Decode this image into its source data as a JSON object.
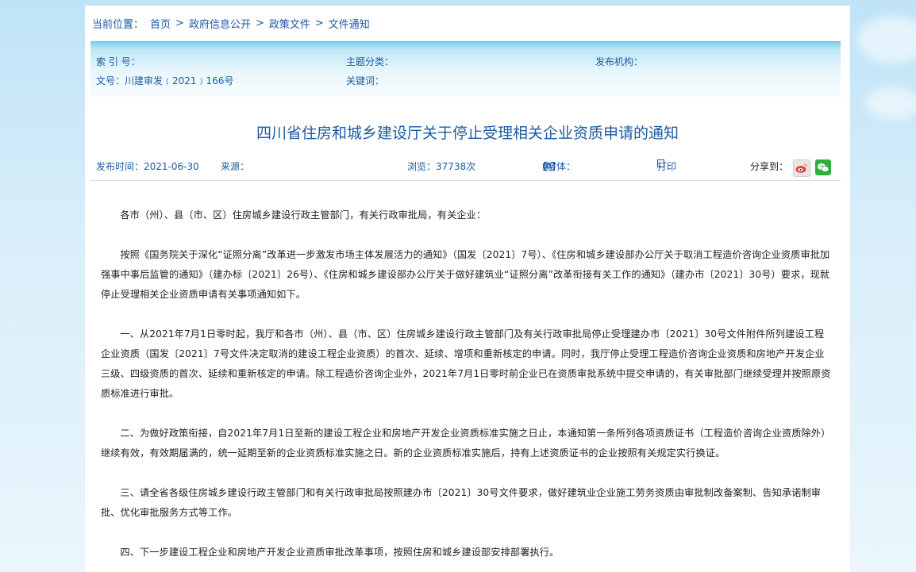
{
  "breadcrumb": {
    "label": "当前位置：",
    "items": [
      "首页",
      "政府信息公开",
      "政策文件",
      "文件通知"
    ],
    "separator": ">"
  },
  "meta": {
    "index_label": "索 引 号：",
    "topic_label": "主题分类：",
    "org_label": "发布机构：",
    "docno_label": "文号：",
    "docno_value": "川建审发﹝2021﹞166号",
    "keywords_label": "关键词："
  },
  "title": "四川省住房和城乡建设厅关于停止受理相关企业资质申请的通知",
  "info": {
    "publish_time": "发布时间：2021-06-30",
    "source": "来源：",
    "views": "浏览：37738次",
    "font_label": "【字体：",
    "font_large": "大",
    "font_medium": "中",
    "font_small": "小】",
    "print_label": "打印",
    "share_label": "分享到："
  },
  "body": {
    "salutation": "各市（州）、县（市、区）住房城乡建设行政主管部门，有关行政审批局，有关企业：",
    "paragraphs": [
      "按照《国务院关于深化“证照分离”改革进一步激发市场主体发展活力的通知》（国发〔2021〕7号）、《住房和城乡建设部办公厅关于取消工程造价咨询企业资质审批加强事中事后监管的通知》（建办标〔2021〕26号）、《住房和城乡建设部办公厅关于做好建筑业“证照分离”改革衔接有关工作的通知》（建办市〔2021〕30号）要求，现就停止受理相关企业资质申请有关事项通知如下。",
      "一、从2021年7月1日零时起，我厅和各市（州）、县（市、区）住房城乡建设行政主管部门及有关行政审批局停止受理建办市〔2021〕30号文件附件所列建设工程企业资质（国发〔2021〕7号文件决定取消的建设工程企业资质）的首次、延续、增项和重新核定的申请。同时，我厅停止受理工程造价咨询企业资质和房地产开发企业三级、四级资质的首次、延续和重新核定的申请。除工程造价咨询企业外，2021年7月1日零时前企业已在资质审批系统中提交申请的，有关审批部门继续受理并按照原资质标准进行审批。",
      "二、为做好政策衔接，自2021年7月1日至新的建设工程企业和房地产开发企业资质标准实施之日止，本通知第一条所列各项资质证书（工程造价咨询企业资质除外）继续有效，有效期届满的，统一延期至新的企业资质标准实施之日。新的企业资质标准实施后，持有上述资质证书的企业按照有关规定实行换证。",
      "三、请全省各级住房城乡建设行政主管部门和有关行政审批局按照建办市〔2021〕30号文件要求，做好建筑业企业施工劳务资质由审批制改备案制、告知承诺制审批、优化审批服务方式等工作。",
      "四、下一步建设工程企业和房地产开发企业资质审批改革事项，按照住房和城乡建设部安排部署执行。"
    ]
  },
  "colors": {
    "link": "#1d5aa3",
    "text": "#222222",
    "wechat": "#2db13b"
  }
}
